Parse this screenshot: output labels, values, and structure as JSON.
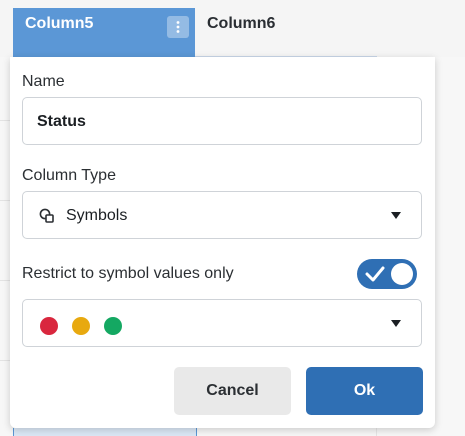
{
  "header": {
    "column5_label": "Column5",
    "column6_label": "Column6"
  },
  "dialog": {
    "name_label": "Name",
    "name_value": "Status",
    "type_label": "Column Type",
    "type_value": "Symbols",
    "restrict_label": "Restrict to symbol values only",
    "restrict_enabled": true,
    "symbols": [
      {
        "color": "#d9273e"
      },
      {
        "color": "#e8a90f"
      },
      {
        "color": "#14a862"
      }
    ],
    "cancel_label": "Cancel",
    "ok_label": "Ok"
  },
  "colors": {
    "accent": "#2f6fb4",
    "header_selected": "#5b97d6"
  }
}
